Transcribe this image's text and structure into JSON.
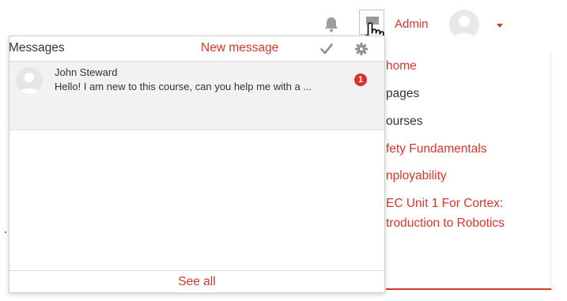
{
  "navbar": {
    "user_name": "Admin",
    "icons": [
      "bell-icon",
      "message-icon",
      "hand-cursor-icon",
      "avatar",
      "caret-down-icon"
    ]
  },
  "background_links": [
    "home",
    "pages",
    "ourses",
    "fety Fundamentals",
    "nployability",
    "EC Unit 1 For Cortex:",
    "troduction to Robotics"
  ],
  "messages_popover": {
    "title": "Messages",
    "new_message_label": "New message",
    "mark_read_icon": "check-icon",
    "settings_icon": "gear-icon",
    "items": [
      {
        "sender": "John Steward",
        "snippet": "Hello! I am new to this course, can you help me with a ...",
        "unread_count": "1"
      }
    ],
    "see_all_label": "See all"
  },
  "colors": {
    "accent": "#d9352b",
    "badge": "#e02d2d",
    "item_bg": "#f2f2f2"
  }
}
